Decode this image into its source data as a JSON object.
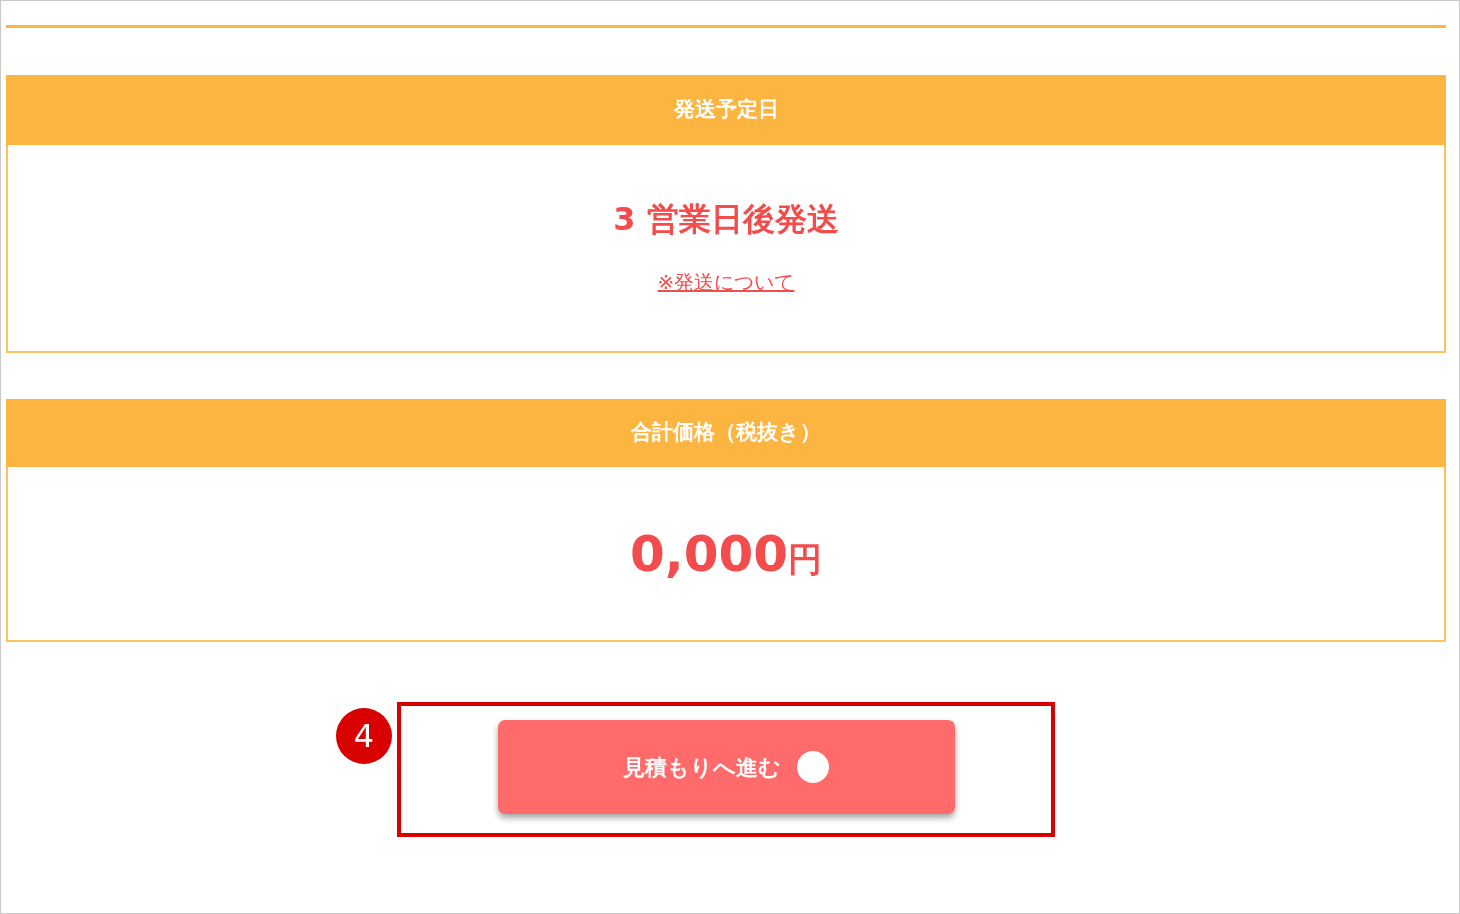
{
  "panels": [
    {
      "kind": "shipping",
      "header": "発送予定日",
      "value": "3 営業日後発送",
      "link": "※発送について"
    },
    {
      "kind": "price",
      "header": "合計価格（税抜き）",
      "amount": "0,000",
      "unit": "円"
    }
  ],
  "button": {
    "label": "見積もりへ進む"
  },
  "callout": {
    "number": "4"
  }
}
